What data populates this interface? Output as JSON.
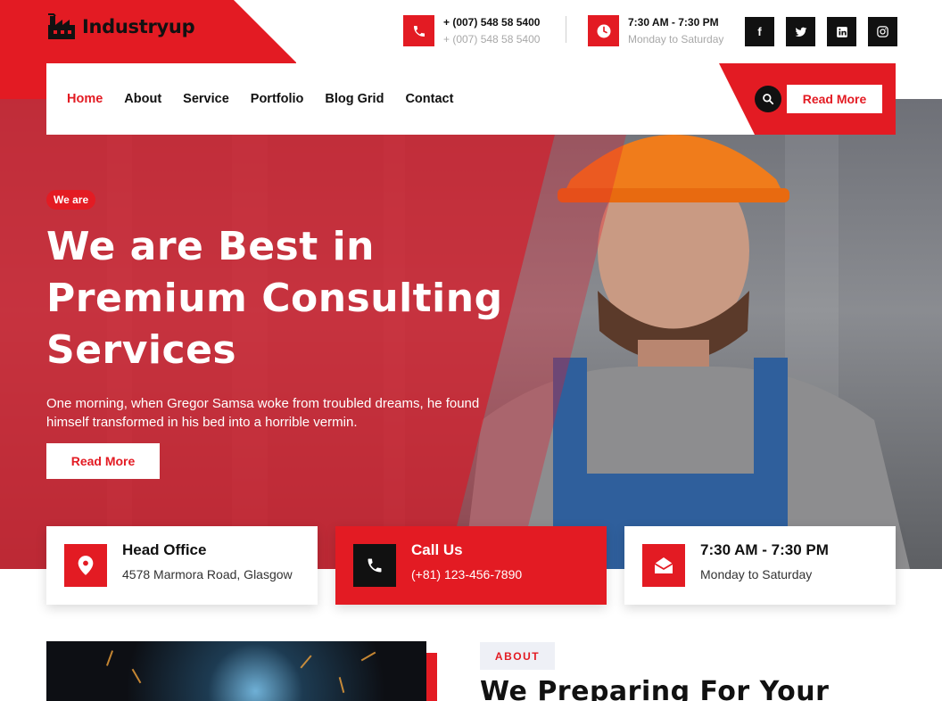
{
  "brand": {
    "name": "Industryup",
    "accent": "#e31b23",
    "dark": "#111111"
  },
  "topbar": {
    "phone": {
      "line1": "+ (007) 548 58 5400",
      "line2": "+ (007) 548 58 5400",
      "icon": "phone-icon"
    },
    "hours": {
      "line1": "7:30 AM - 7:30 PM",
      "line2": "Monday to Saturday",
      "icon": "clock-icon"
    },
    "social": [
      {
        "label": "f",
        "icon": "facebook-icon"
      },
      {
        "label": "t",
        "icon": "twitter-icon"
      },
      {
        "label": "in",
        "icon": "linkedin-icon"
      },
      {
        "label": "ig",
        "icon": "instagram-icon"
      }
    ]
  },
  "nav": {
    "items": [
      "Home",
      "About",
      "Service",
      "Portfolio",
      "Blog Grid",
      "Contact"
    ],
    "active": "Home",
    "cta": "Read More"
  },
  "hero": {
    "tag": "We are",
    "title_line1": "We are Best in",
    "title_line2": "Premium Consulting",
    "title_line3": "Services",
    "lead": "One morning, when Gregor Samsa woke from troubled dreams, he found himself transformed in his bed into a horrible vermin.",
    "button": "Read More"
  },
  "cards": [
    {
      "title": "Head Office",
      "sub": "4578 Marmora Road, Glasgow",
      "icon": "location-pin-icon"
    },
    {
      "title": "Call Us",
      "sub": "(+81) 123-456-7890",
      "icon": "phone-icon"
    },
    {
      "title": "7:30 AM - 7:30 PM",
      "sub": "Monday to Saturday",
      "icon": "envelope-icon"
    }
  ],
  "about": {
    "tag": "ABOUT",
    "heading": "We Preparing For Your"
  }
}
